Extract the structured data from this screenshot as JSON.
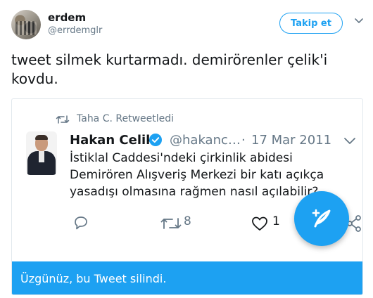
{
  "author": {
    "display_name": "erdem",
    "handle": "@errdemglr",
    "follow_label": "Takip et"
  },
  "tweet": {
    "text": "tweet silmek kurtarmadı. demirörenler çelik'i kovdu."
  },
  "quoted": {
    "retweet_context": "Taha C. Retweetledi",
    "name": "Hakan Celik",
    "handle": "@hakanc…",
    "dot": "·",
    "date": "17 Mar 2011",
    "text": "İstiklal Caddesi'ndeki çirkinlik abidesi Demirören Alışveriş Merkezi bir katı açıkça yasadışı olmasına rağmen nasıl açılabilir?",
    "retweet_count": "8",
    "like_count": "1",
    "deleted_notice": "Üzgünüz, bu Tweet silindi."
  },
  "colors": {
    "accent": "#1da1f2",
    "text": "#14171a",
    "muted": "#657786",
    "border": "#e1e8ed"
  },
  "icons": [
    "chevron-down-icon",
    "retweet-icon",
    "verified-icon",
    "reply-icon",
    "like-icon",
    "share-icon",
    "compose-icon"
  ]
}
